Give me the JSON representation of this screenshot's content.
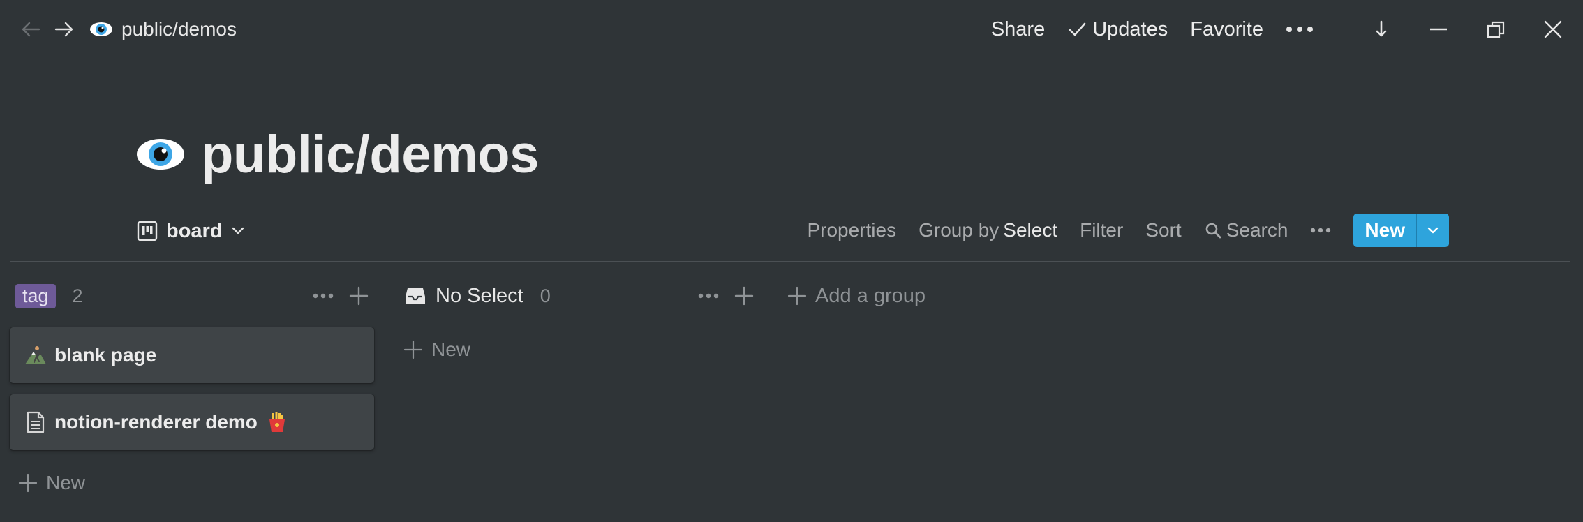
{
  "topbar": {
    "breadcrumb": "public/demos",
    "share_label": "Share",
    "updates_label": "Updates",
    "favorite_label": "Favorite"
  },
  "page": {
    "title": "public/demos"
  },
  "view": {
    "name": "board",
    "properties_label": "Properties",
    "group_by_prefix": "Group by",
    "group_by_value": "Select",
    "filter_label": "Filter",
    "sort_label": "Sort",
    "search_label": "Search",
    "new_label": "New"
  },
  "board": {
    "groups": [
      {
        "label": "tag",
        "count": "2",
        "cards": [
          {
            "title": "blank page"
          },
          {
            "title": "notion-renderer demo"
          }
        ],
        "new_label": "New"
      },
      {
        "label": "No Select",
        "count": "0",
        "new_label": "New"
      }
    ],
    "add_group_label": "Add a group"
  },
  "colors": {
    "background": "#2f3437",
    "card": "#3f4447",
    "accent": "#2ea4dc",
    "tag": "#6e5a98",
    "muted_text": "#8f9396"
  },
  "icons": {
    "back": "arrow-left-icon",
    "forward": "arrow-right-icon",
    "page": "eye-icon",
    "updates": "check-icon",
    "more": "ellipsis-icon",
    "download": "download-icon",
    "minimize": "minimize-icon",
    "restore": "restore-icon",
    "close": "close-icon",
    "board": "board-icon",
    "search": "search-icon",
    "no_select": "inbox-icon",
    "card1": "hiker-icon",
    "card2": "page-icon",
    "fries": "fries-icon"
  }
}
